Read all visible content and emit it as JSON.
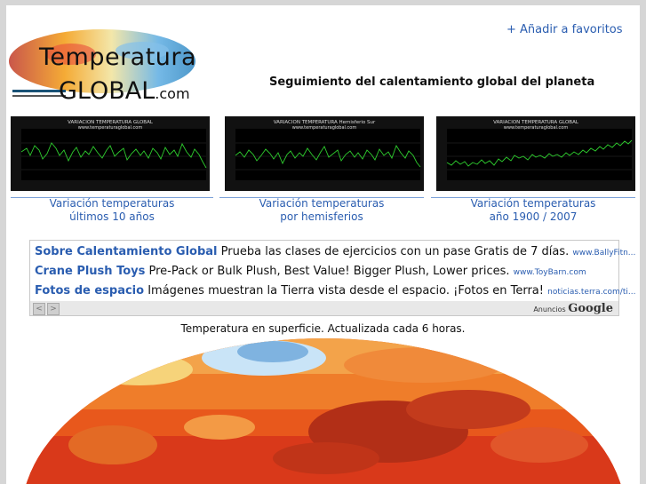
{
  "header": {
    "logo": {
      "word1": "Temperatura",
      "word2": "GLOBAL",
      "suffix": ".com"
    },
    "favorites_link": "+ Añadir a favoritos",
    "tagline": "Seguimiento del calentamiento global del planeta"
  },
  "graphs": [
    {
      "title": "VARIACION TEMPERATURA GLOBAL",
      "url": "www.temperaturaglobal.com",
      "caption_line1": "Variación temperaturas",
      "caption_line2": "últimos 10 años"
    },
    {
      "title": "VARIACION TEMPERATURA Hemisferio Sur",
      "url": "www.temperaturaglobal.com",
      "caption_line1": "Variación temperaturas",
      "caption_line2": "por hemisferios"
    },
    {
      "title": "VARIACION TEMPERATURA GLOBAL",
      "url": "www.temperaturaglobal.com",
      "caption_line1": "Variación temperaturas",
      "caption_line2": "año 1900 / 2007"
    }
  ],
  "ads": [
    {
      "headline": "Sobre Calentamiento Global",
      "text": "Prueba las clases de ejercicios con un pase Gratis de 7 días.",
      "url": "www.BallyFitn..."
    },
    {
      "headline": "Crane Plush Toys",
      "text": "Pre-Pack or Bulk Plush, Best Value! Bigger Plush, Lower prices.",
      "url": "www.ToyBarn.com"
    },
    {
      "headline": "Fotos de espacio",
      "text": "Imágenes muestran la Tierra vista desde el espacio. ¡Fotos en Terra!",
      "url": "noticias.terra.com/ti..."
    }
  ],
  "ads_footer": {
    "label": "Anuncios",
    "brand": "Google",
    "prev": "<",
    "next": ">"
  },
  "map_caption": "Temperatura en superficie. Actualizada cada 6 horas.",
  "colors": {
    "link": "#2a5db0",
    "graph_line": "#2ecc2e",
    "background": "#d6d6d6"
  }
}
